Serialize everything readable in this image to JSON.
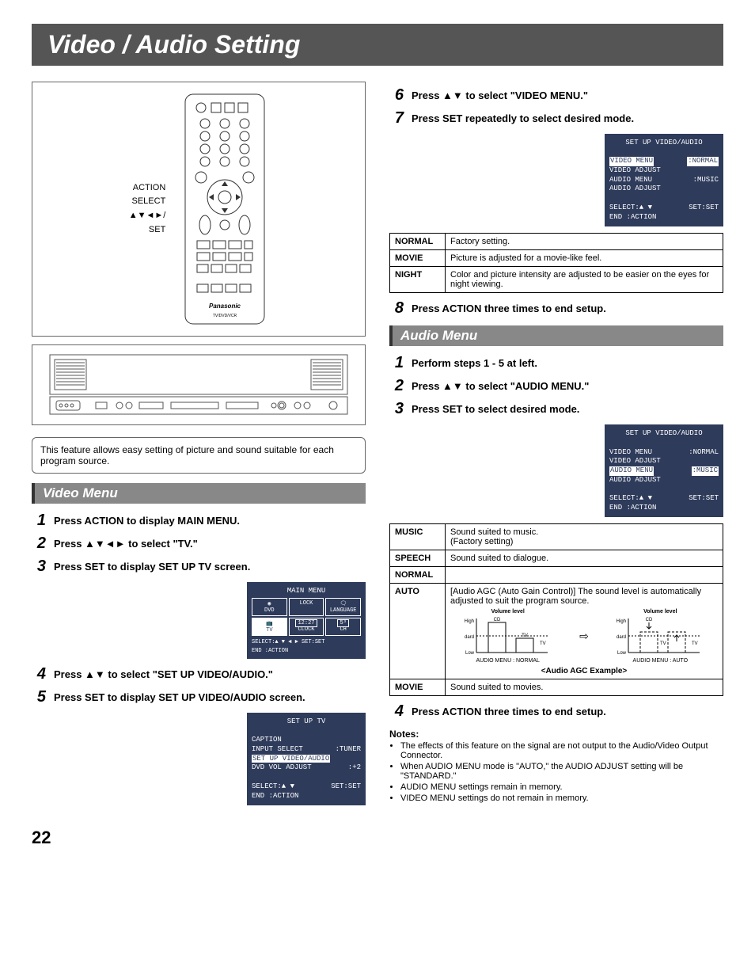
{
  "page_number": "22",
  "title": "Video / Audio Setting",
  "remote_labels": {
    "l1": "ACTION",
    "l2": "SELECT",
    "l3": "▲▼◄►/",
    "l4": "SET"
  },
  "intro": "This feature allows easy setting of picture and sound suitable for each program source.",
  "video": {
    "heading": "Video Menu",
    "s1": "Press ACTION to display MAIN MENU.",
    "s2": "Press ▲▼◄► to select \"TV.\"",
    "s3": "Press SET to display SET UP TV screen.",
    "s4": "Press ▲▼ to select \"SET UP VIDEO/AUDIO.\"",
    "s5": "Press SET to display SET UP VIDEO/AUDIO screen.",
    "s6": "Press ▲▼ to select \"VIDEO MENU.\"",
    "s7": "Press SET repeatedly to select desired mode.",
    "s8": "Press ACTION three times to end setup.",
    "table": {
      "normal_k": "NORMAL",
      "normal_v": "Factory setting.",
      "movie_k": "MOVIE",
      "movie_v": "Picture is adjusted for a movie-like feel.",
      "night_k": "NIGHT",
      "night_v": "Color and picture intensity are adjusted to be easier on the eyes for night viewing."
    }
  },
  "audio": {
    "heading": "Audio Menu",
    "s1": "Perform steps 1 - 5 at left.",
    "s2": "Press ▲▼ to select \"AUDIO MENU.\"",
    "s3": "Press SET to select desired mode.",
    "s4": "Press ACTION three times to end setup.",
    "table": {
      "music_k": "MUSIC",
      "music_v": "Sound suited to music.\n(Factory setting)",
      "speech_k": "SPEECH",
      "speech_v": "Sound suited to dialogue.",
      "normal_k": "NORMAL",
      "normal_v": "",
      "auto_k": "AUTO",
      "auto_v": "[Audio AGC (Auto Gain Control)] The sound level is automatically adjusted to suit the program source.",
      "movie_k": "MOVIE",
      "movie_v": "Sound suited to movies."
    },
    "agc": {
      "left_cap": "AUDIO MENU : NORMAL",
      "right_cap": "AUDIO MENU : AUTO",
      "title": "<Audio AGC Example>",
      "vl": "Volume level",
      "high": "High",
      "low": "Low",
      "std": "Standard",
      "cd": "CD",
      "tv": "TV"
    }
  },
  "main_menu": {
    "title": "MAIN MENU",
    "dvd": "DVD",
    "lock": "LOCK",
    "lang": "LANGUAGE",
    "tv": "TV",
    "clock": "CLOCK",
    "ch": "CH",
    "foot1": "SELECT:▲ ▼ ◄ ►   SET:SET",
    "foot2": "END   :ACTION"
  },
  "osd_setup_tv": {
    "title": "SET UP TV",
    "r1": "CAPTION",
    "r2a": "INPUT SELECT",
    "r2b": ":TUNER",
    "r3": "SET UP VIDEO/AUDIO",
    "r4a": "DVD VOL ADJUST",
    "r4b": ":+2",
    "foot1a": "SELECT:▲ ▼",
    "foot1b": "SET:SET",
    "foot2": "END   :ACTION"
  },
  "osd_va_video": {
    "title": "SET UP VIDEO/AUDIO",
    "r1a": "VIDEO MENU",
    "r1b": ":NORMAL",
    "r2": "VIDEO ADJUST",
    "r3a": "AUDIO MENU",
    "r3b": ":MUSIC",
    "r4": "AUDIO ADJUST",
    "foot1a": "SELECT:▲ ▼",
    "foot1b": "SET:SET",
    "foot2": "END   :ACTION"
  },
  "osd_va_audio": {
    "title": "SET UP VIDEO/AUDIO",
    "r1a": "VIDEO MENU",
    "r1b": ":NORMAL",
    "r2": "VIDEO ADJUST",
    "r3a": "AUDIO MENU",
    "r3b": ":MUSIC",
    "r4": "AUDIO ADJUST",
    "foot1a": "SELECT:▲ ▼",
    "foot1b": "SET:SET",
    "foot2": "END   :ACTION"
  },
  "notes": {
    "h": "Notes:",
    "n1": "The effects of this feature on the signal are not output to the Audio/Video Output Connector.",
    "n2": "When AUDIO MENU mode is \"AUTO,\" the AUDIO ADJUST setting will be \"STANDARD.\"",
    "n3": "AUDIO MENU settings remain in memory.",
    "n4": "VIDEO MENU settings do not remain in memory."
  },
  "brand": "Panasonic",
  "remote_model": "TV/DVD/VCR"
}
